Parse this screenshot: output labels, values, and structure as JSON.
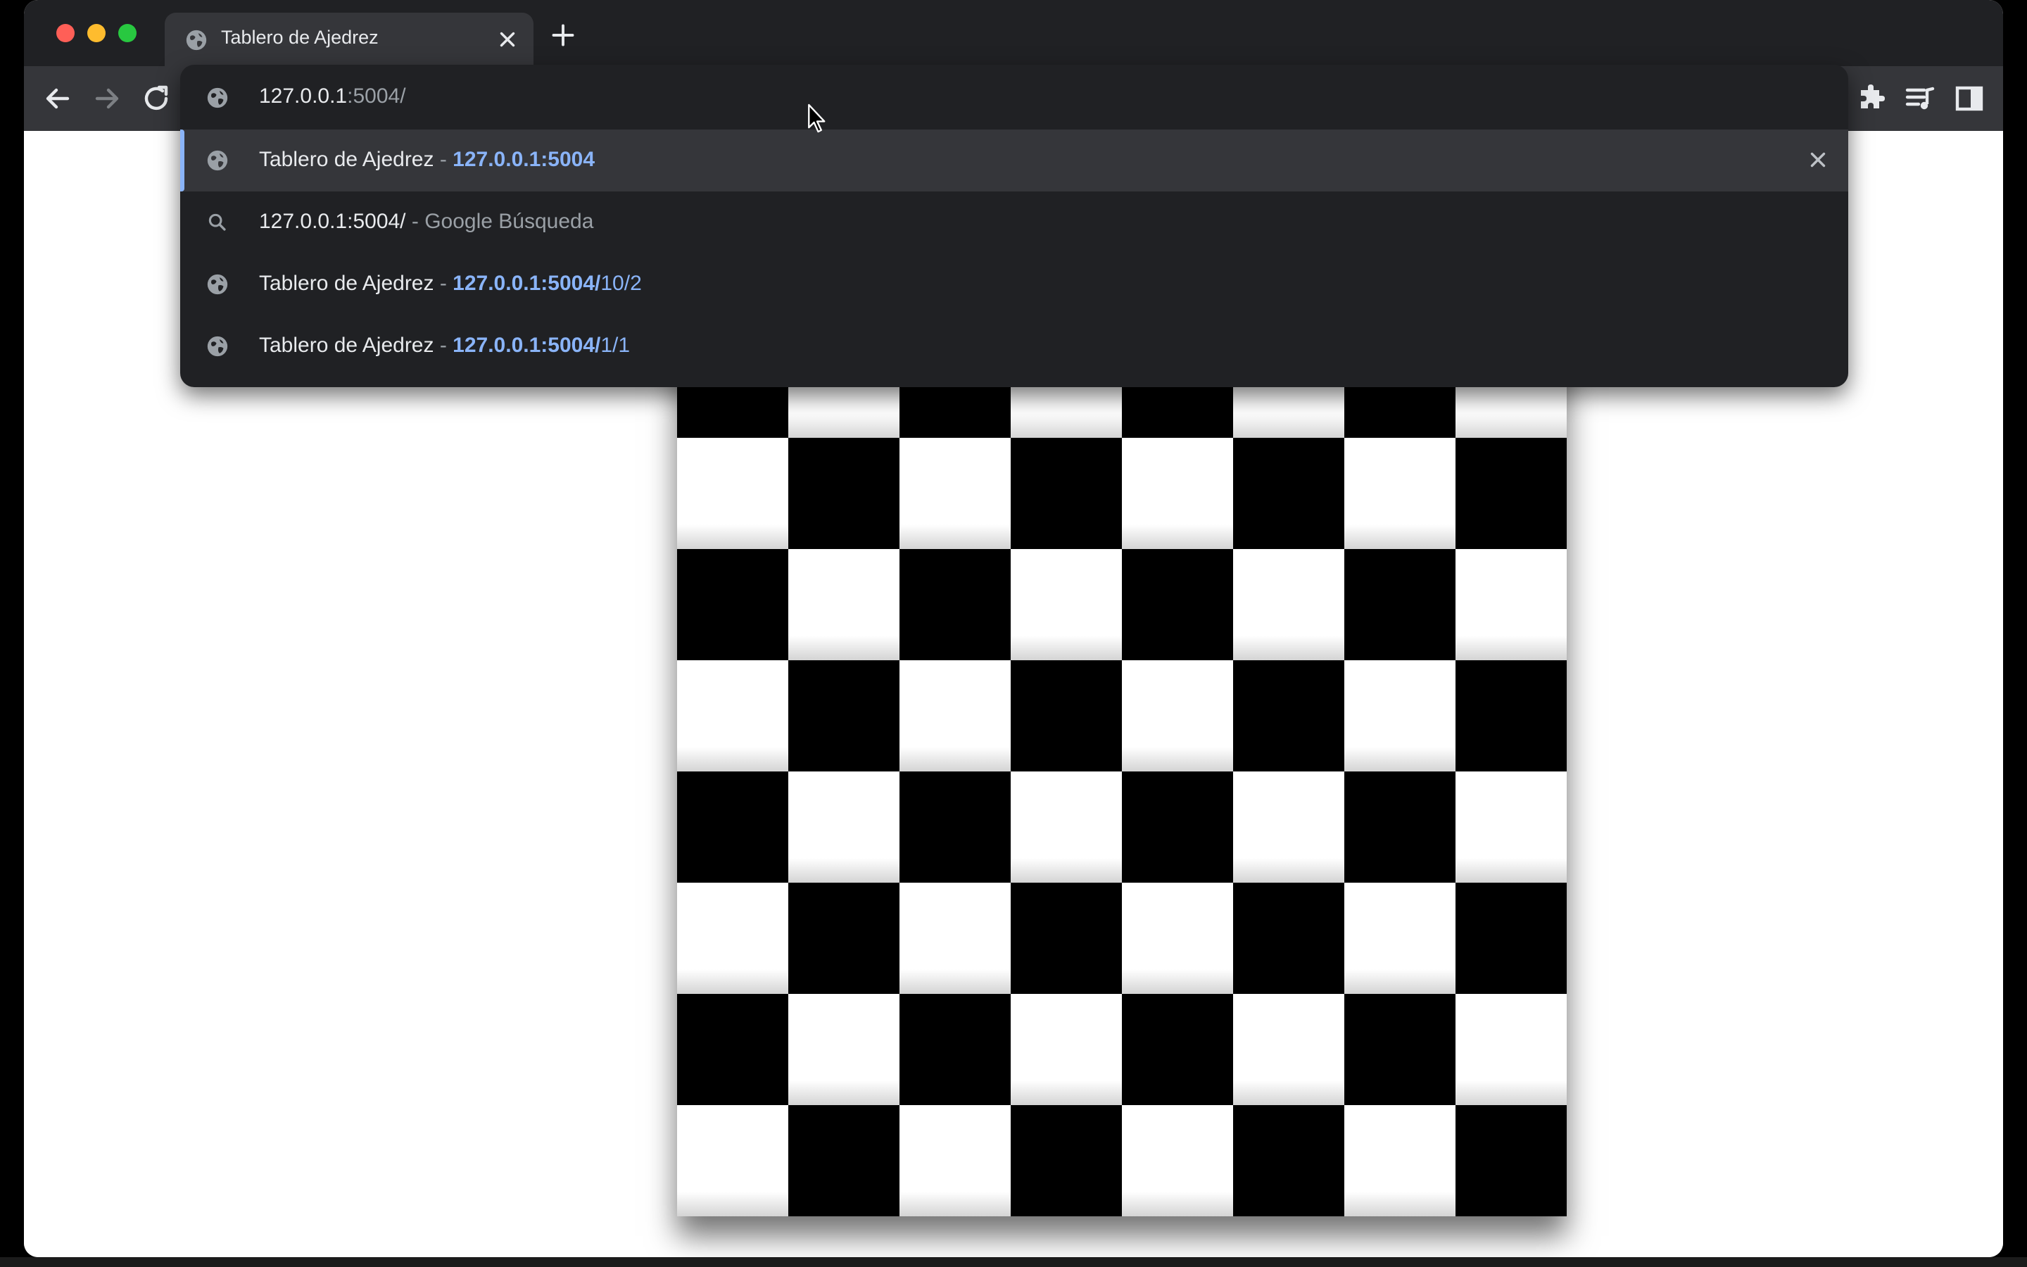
{
  "tab": {
    "title": "Tablero de Ajedrez",
    "close_label": "✕"
  },
  "omnibox": {
    "typed": "127.0.0.1",
    "completion": ":5004/"
  },
  "suggestions": [
    {
      "title": "Tablero de Ajedrez",
      "sep": " - ",
      "url_bold": "127.0.0.1:5004",
      "url_rest": ""
    },
    {
      "query": "127.0.0.1:5004/",
      "sep": " - ",
      "desc": "Google Búsqueda"
    },
    {
      "title": "Tablero de Ajedrez",
      "sep": " - ",
      "url_bold": "127.0.0.1:5004/",
      "url_rest": "10/2"
    },
    {
      "title": "Tablero de Ajedrez",
      "sep": " - ",
      "url_bold": "127.0.0.1:5004/",
      "url_rest": "1/1"
    }
  ],
  "board": {
    "size": 8,
    "top_left_color": "black",
    "dark": "#000000",
    "light": "#ffffff"
  },
  "colors": {
    "chrome_dark": "#202124",
    "toolbar": "#35363a",
    "accent": "#8ab4f8"
  },
  "icons": [
    "globe-icon",
    "close-icon",
    "plus-icon",
    "back-arrow-icon",
    "forward-arrow-icon",
    "reload-icon",
    "search-icon",
    "puzzle-icon",
    "media-queue-icon",
    "side-panel-icon",
    "mouse-cursor-icon"
  ]
}
